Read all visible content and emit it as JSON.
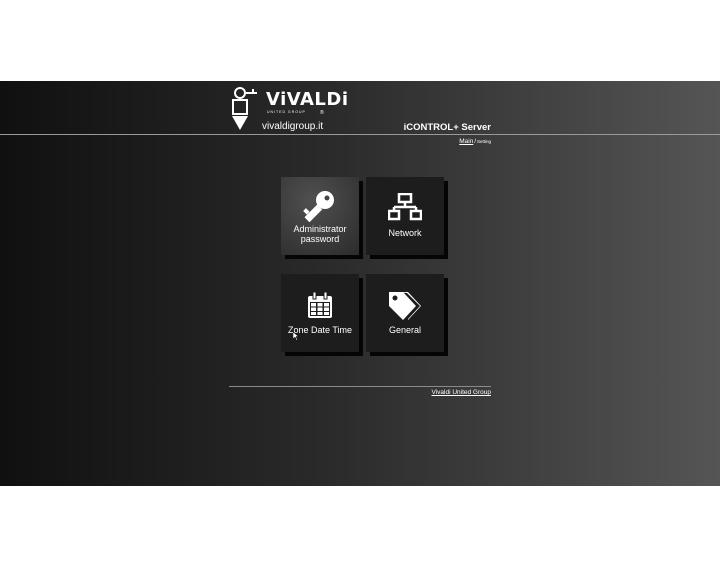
{
  "brand": {
    "name": "ViVALDi",
    "sub": "UNITED GROUP",
    "reg": "®",
    "site": "vivaldigroup.it"
  },
  "header": {
    "title": "iCONTROL+ Server"
  },
  "breadcrumb": {
    "main": "Main",
    "separator": "/",
    "current": "Setting"
  },
  "tiles": [
    {
      "label_line1": "Administrator",
      "label_line2": "password",
      "icon": "key-icon"
    },
    {
      "label": "Network",
      "icon": "network-icon"
    },
    {
      "label": "Zone Date Time",
      "icon": "calendar-icon"
    },
    {
      "label": "General",
      "icon": "tags-icon"
    }
  ],
  "footer": {
    "link": "Vivaldi United Group"
  }
}
